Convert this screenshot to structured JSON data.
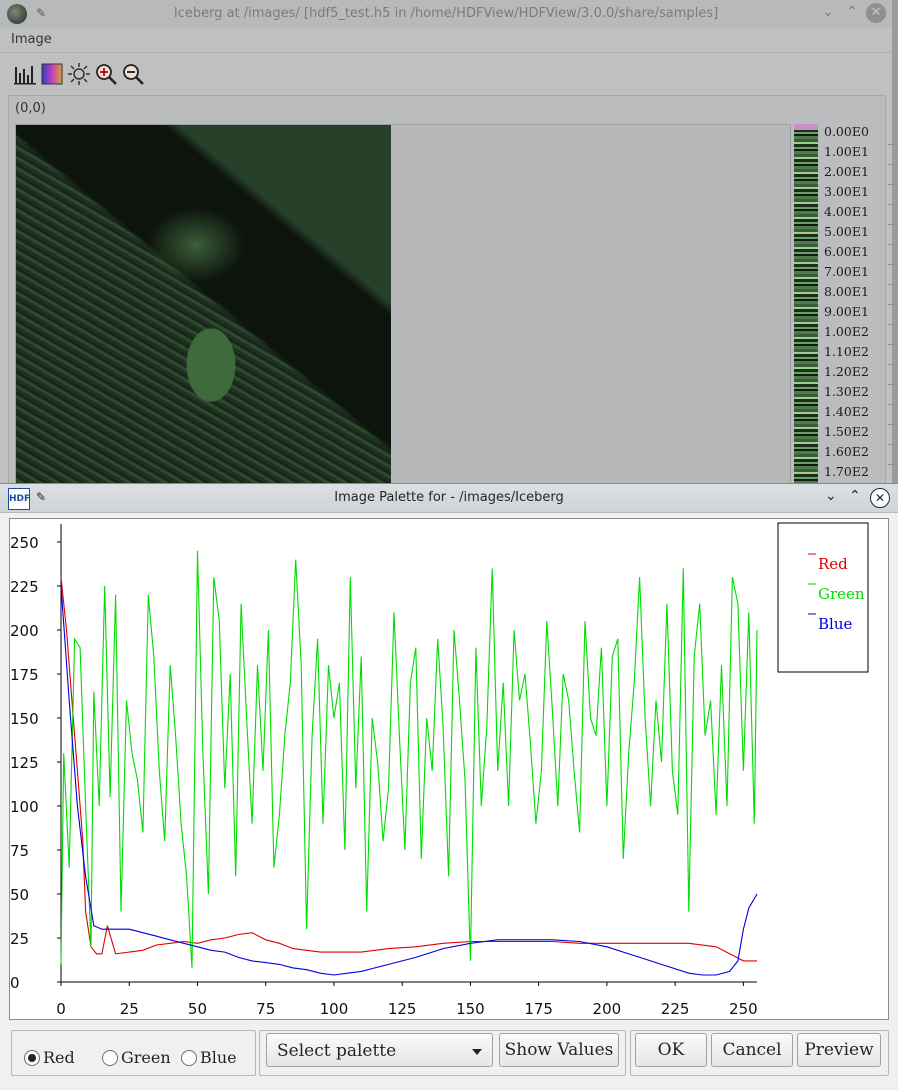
{
  "background_window": {
    "title": "Iceberg at /images/ [hdf5_test.h5 in /home/HDFView/HDFView/3.0.0/share/samples]",
    "menu": [
      "Image"
    ],
    "toolbar_icons": [
      "histogram-icon",
      "palette-icon",
      "brightness-icon",
      "zoom-in-icon",
      "zoom-out-icon"
    ],
    "coordinate": "(0,0)",
    "colorbar_labels": [
      "0.00E0",
      "1.00E1",
      "2.00E1",
      "3.00E1",
      "4.00E1",
      "5.00E1",
      "6.00E1",
      "7.00E1",
      "8.00E1",
      "9.00E1",
      "1.00E2",
      "1.10E2",
      "1.20E2",
      "1.30E2",
      "1.40E2",
      "1.50E2",
      "1.60E2",
      "1.70E2"
    ]
  },
  "dialog": {
    "title": "Image Palette for - /images/Iceberg",
    "radios": [
      {
        "label": "Red",
        "selected": true
      },
      {
        "label": "Green",
        "selected": false
      },
      {
        "label": "Blue",
        "selected": false
      }
    ],
    "palette_select": "Select palette",
    "show_values": "Show Values",
    "ok": "OK",
    "cancel": "Cancel",
    "preview": "Preview"
  },
  "chart_data": {
    "type": "line",
    "xlim": [
      0,
      255
    ],
    "ylim": [
      0,
      250
    ],
    "xticks": [
      0,
      25,
      50,
      75,
      100,
      125,
      150,
      175,
      200,
      225,
      250
    ],
    "yticks": [
      0,
      25,
      50,
      75,
      100,
      125,
      150,
      175,
      200,
      225,
      250
    ],
    "legend_position": "top-right",
    "series": [
      {
        "name": "Red",
        "color": "#dd0000",
        "x": [
          0,
          2,
          4,
          6,
          8,
          9,
          11,
          13,
          15,
          17,
          20,
          25,
          30,
          35,
          40,
          45,
          50,
          55,
          60,
          65,
          70,
          75,
          80,
          85,
          90,
          95,
          100,
          110,
          120,
          130,
          140,
          150,
          160,
          170,
          180,
          190,
          200,
          210,
          220,
          230,
          240,
          245,
          250,
          255
        ],
        "y": [
          230,
          200,
          160,
          120,
          80,
          40,
          20,
          16,
          16,
          32,
          16,
          17,
          18,
          21,
          22,
          23,
          22,
          24,
          25,
          27,
          28,
          24,
          22,
          19,
          18,
          17,
          17,
          17,
          19,
          20,
          22,
          23,
          23,
          23,
          23,
          22,
          22,
          22,
          22,
          22,
          20,
          16,
          12,
          12
        ]
      },
      {
        "name": "Green",
        "color": "#00dd00",
        "x": [
          0,
          1,
          3,
          5,
          7,
          9,
          11,
          12,
          14,
          16,
          18,
          20,
          22,
          24,
          26,
          28,
          30,
          32,
          34,
          36,
          38,
          40,
          42,
          44,
          46,
          48,
          50,
          52,
          54,
          56,
          58,
          60,
          62,
          64,
          66,
          68,
          70,
          72,
          74,
          76,
          78,
          80,
          82,
          84,
          86,
          88,
          90,
          92,
          94,
          96,
          98,
          100,
          102,
          104,
          106,
          108,
          110,
          112,
          114,
          116,
          118,
          120,
          122,
          124,
          126,
          128,
          130,
          132,
          134,
          136,
          138,
          140,
          142,
          144,
          146,
          148,
          150,
          152,
          154,
          156,
          158,
          160,
          162,
          164,
          166,
          168,
          170,
          172,
          174,
          176,
          178,
          180,
          182,
          184,
          186,
          188,
          190,
          192,
          194,
          196,
          198,
          200,
          202,
          204,
          206,
          208,
          210,
          212,
          214,
          216,
          218,
          220,
          222,
          224,
          226,
          228,
          230,
          232,
          234,
          236,
          238,
          240,
          242,
          244,
          246,
          248,
          250,
          252,
          254,
          255
        ],
        "y": [
          10,
          130,
          65,
          195,
          190,
          100,
          20,
          165,
          100,
          225,
          105,
          220,
          40,
          160,
          130,
          115,
          85,
          220,
          185,
          120,
          80,
          180,
          140,
          90,
          60,
          8,
          245,
          130,
          50,
          230,
          205,
          110,
          175,
          60,
          215,
          150,
          90,
          180,
          120,
          200,
          65,
          95,
          140,
          170,
          240,
          180,
          30,
          140,
          195,
          90,
          180,
          150,
          170,
          75,
          230,
          110,
          185,
          40,
          150,
          125,
          80,
          110,
          210,
          140,
          75,
          170,
          190,
          70,
          150,
          120,
          195,
          145,
          60,
          200,
          160,
          115,
          12,
          190,
          100,
          145,
          235,
          120,
          170,
          100,
          200,
          160,
          175,
          135,
          90,
          120,
          205,
          155,
          100,
          175,
          160,
          120,
          85,
          205,
          150,
          140,
          190,
          100,
          185,
          195,
          70,
          130,
          170,
          230,
          150,
          100,
          160,
          125,
          215,
          120,
          95,
          235,
          40,
          185,
          215,
          140,
          160,
          95,
          180,
          100,
          230,
          215,
          120,
          210,
          90,
          200
        ]
      },
      {
        "name": "Blue",
        "color": "#0000dd",
        "x": [
          0,
          3,
          6,
          9,
          12,
          15,
          20,
          25,
          30,
          35,
          40,
          45,
          50,
          55,
          60,
          65,
          70,
          75,
          80,
          85,
          90,
          95,
          100,
          105,
          110,
          115,
          120,
          130,
          140,
          150,
          160,
          170,
          180,
          190,
          200,
          210,
          220,
          230,
          235,
          240,
          245,
          248,
          250,
          252,
          255
        ],
        "y": [
          225,
          160,
          100,
          60,
          32,
          30,
          30,
          30,
          28,
          26,
          24,
          22,
          20,
          18,
          17,
          14,
          12,
          11,
          10,
          8,
          7,
          5,
          4,
          5,
          6,
          8,
          10,
          14,
          19,
          22,
          24,
          24,
          24,
          23,
          20,
          15,
          10,
          5,
          4,
          4,
          6,
          12,
          30,
          42,
          50
        ]
      }
    ]
  }
}
